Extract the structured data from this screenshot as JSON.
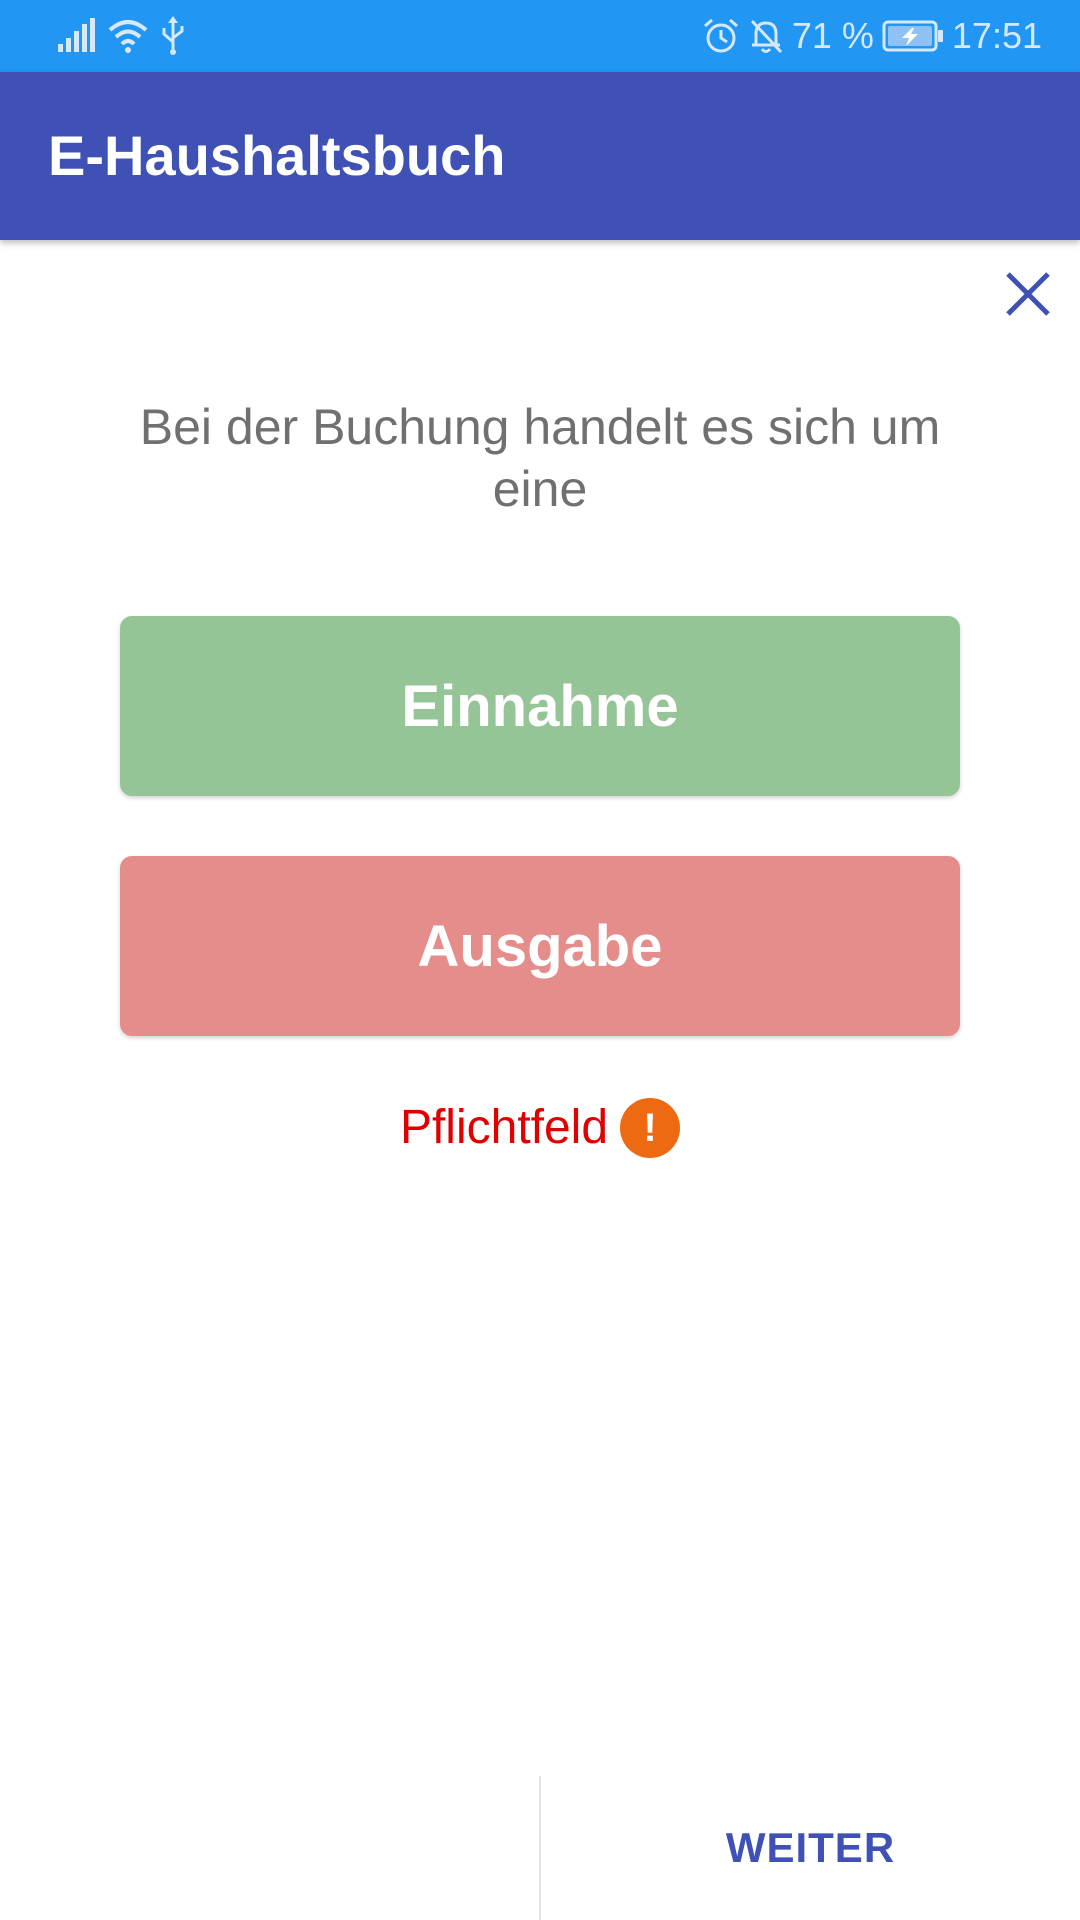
{
  "status_bar": {
    "battery_percent": "71 %",
    "time": "17:51",
    "icons": [
      "signal-icon",
      "wifi-icon",
      "usb-icon",
      "alarm-icon",
      "notifications-off-icon",
      "battery-charging-icon"
    ]
  },
  "app_bar": {
    "title": "E-Haushaltsbuch"
  },
  "dialog": {
    "close_icon": "close-icon",
    "prompt": "Bei der Buchung handelt es sich um eine",
    "options": [
      {
        "label": "Einnahme",
        "color": "#95C497"
      },
      {
        "label": "Ausgabe",
        "color": "#E48D8B"
      }
    ],
    "validation": {
      "label": "Pflichtfeld",
      "icon": "warning-icon",
      "icon_glyph": "!",
      "color": "#E00000",
      "icon_color": "#EE6A12"
    }
  },
  "footer": {
    "next_label": "WEITER"
  },
  "colors": {
    "status_bar": "#2196F3",
    "primary": "#3F51B5"
  }
}
